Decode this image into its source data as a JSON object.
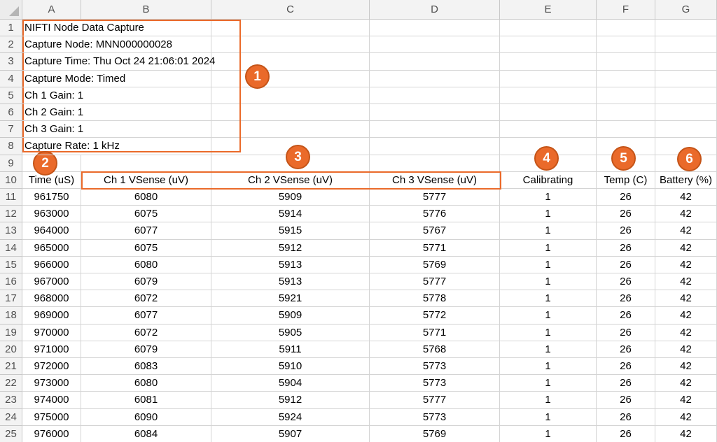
{
  "sheet": {
    "columns": [
      "A",
      "B",
      "C",
      "D",
      "E",
      "F",
      "G"
    ],
    "metadata": [
      "NIFTI Node Data Capture",
      "Capture Node: MNN000000028",
      "Capture Time: Thu Oct 24 21:06:01 2024",
      "Capture Mode: Timed",
      "Ch 1 Gain: 1",
      "Ch 2 Gain: 1",
      "Ch 3 Gain: 1",
      "Capture Rate:  1 kHz"
    ],
    "headers": [
      "Time (uS)",
      "Ch 1 VSense (uV)",
      "Ch 2 VSense (uV)",
      "Ch 3 VSense (uV)",
      "Calibrating",
      "Temp (C)",
      "Battery (%)"
    ],
    "rows": [
      [
        "961750",
        "6080",
        "5909",
        "5777",
        "1",
        "26",
        "42"
      ],
      [
        "963000",
        "6075",
        "5914",
        "5776",
        "1",
        "26",
        "42"
      ],
      [
        "964000",
        "6077",
        "5915",
        "5767",
        "1",
        "26",
        "42"
      ],
      [
        "965000",
        "6075",
        "5912",
        "5771",
        "1",
        "26",
        "42"
      ],
      [
        "966000",
        "6080",
        "5913",
        "5769",
        "1",
        "26",
        "42"
      ],
      [
        "967000",
        "6079",
        "5913",
        "5777",
        "1",
        "26",
        "42"
      ],
      [
        "968000",
        "6072",
        "5921",
        "5778",
        "1",
        "26",
        "42"
      ],
      [
        "969000",
        "6077",
        "5909",
        "5772",
        "1",
        "26",
        "42"
      ],
      [
        "970000",
        "6072",
        "5905",
        "5771",
        "1",
        "26",
        "42"
      ],
      [
        "971000",
        "6079",
        "5911",
        "5768",
        "1",
        "26",
        "42"
      ],
      [
        "972000",
        "6083",
        "5910",
        "5773",
        "1",
        "26",
        "42"
      ],
      [
        "973000",
        "6080",
        "5904",
        "5773",
        "1",
        "26",
        "42"
      ],
      [
        "974000",
        "6081",
        "5912",
        "5777",
        "1",
        "26",
        "42"
      ],
      [
        "975000",
        "6090",
        "5924",
        "5773",
        "1",
        "26",
        "42"
      ],
      [
        "976000",
        "6084",
        "5907",
        "5769",
        "1",
        "26",
        "42"
      ]
    ]
  },
  "annotations": {
    "accent_color": "#ea6a2a",
    "badges": [
      "1",
      "2",
      "3",
      "4",
      "5",
      "6"
    ]
  }
}
